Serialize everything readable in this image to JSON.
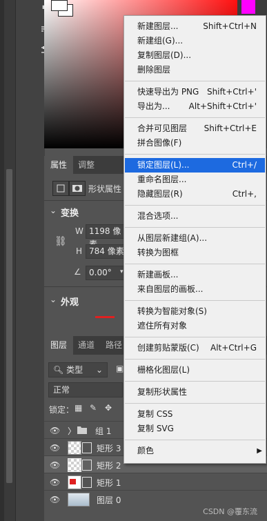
{
  "tools": {
    "icons": [
      "brush-settings-icon",
      "sliders-icon"
    ]
  },
  "properties": {
    "tabs": [
      "属性",
      "调整"
    ],
    "shape_label": "形状属性",
    "transform_header": "变换",
    "w_label": "W",
    "w_value": "1198 像素",
    "h_label": "H",
    "h_value": "784 像素",
    "angle_value": "0.00°",
    "appearance_header": "外观"
  },
  "layers": {
    "tabs": [
      "图层",
      "通道",
      "路径"
    ],
    "filter_kind": "类型",
    "blend_mode": "正常",
    "lock_label": "锁定：",
    "rows": [
      {
        "name": "组 1",
        "kind": "group",
        "selected": false
      },
      {
        "name": "矩形 3",
        "kind": "rect",
        "selected": false
      },
      {
        "name": "矩形 2",
        "kind": "rect",
        "selected": true
      },
      {
        "name": "矩形 1",
        "kind": "rect-red",
        "selected": false
      },
      {
        "name": "图层 0",
        "kind": "image",
        "selected": false
      }
    ]
  },
  "context_menu": {
    "items": [
      {
        "label": "新建图层...",
        "shortcut": "Shift+Ctrl+N"
      },
      {
        "label": "新建组(G)...",
        "shortcut": ""
      },
      {
        "label": "复制图层(D)...",
        "shortcut": ""
      },
      {
        "label": "删除图层",
        "shortcut": ""
      },
      {
        "sep": true
      },
      {
        "label": "快速导出为 PNG",
        "shortcut": "Shift+Ctrl+'"
      },
      {
        "label": "导出为...",
        "shortcut": "Alt+Shift+Ctrl+'"
      },
      {
        "sep": true
      },
      {
        "label": "合并可见图层",
        "shortcut": "Shift+Ctrl+E"
      },
      {
        "label": "拼合图像(F)",
        "shortcut": ""
      },
      {
        "sep": true
      },
      {
        "label": "锁定图层(L)...",
        "shortcut": "Ctrl+/",
        "highlight": true
      },
      {
        "label": "重命名图层...",
        "shortcut": ""
      },
      {
        "label": "隐藏图层(R)",
        "shortcut": "Ctrl+,"
      },
      {
        "sep": true
      },
      {
        "label": "混合选项...",
        "shortcut": ""
      },
      {
        "sep": true
      },
      {
        "label": "从图层新建组(A)...",
        "shortcut": ""
      },
      {
        "label": "转换为图框",
        "shortcut": ""
      },
      {
        "sep": true
      },
      {
        "label": "新建画板...",
        "shortcut": ""
      },
      {
        "label": "来自图层的画板...",
        "shortcut": ""
      },
      {
        "sep": true
      },
      {
        "label": "转换为智能对象(S)",
        "shortcut": ""
      },
      {
        "label": "遮住所有对象",
        "shortcut": ""
      },
      {
        "sep": true
      },
      {
        "label": "创建剪贴蒙版(C)",
        "shortcut": "Alt+Ctrl+G"
      },
      {
        "sep": true
      },
      {
        "label": "栅格化图层(L)",
        "shortcut": ""
      },
      {
        "sep": true
      },
      {
        "label": "复制形状属性",
        "shortcut": ""
      },
      {
        "sep": true
      },
      {
        "label": "复制 CSS",
        "shortcut": ""
      },
      {
        "label": "复制 SVG",
        "shortcut": ""
      },
      {
        "sep": true
      },
      {
        "label": "颜色",
        "shortcut": "",
        "submenu": true
      }
    ]
  },
  "watermark": "CSDN @覆东流",
  "colors": {
    "menu_highlight": "#1d6ae0",
    "hue_marker": "#ff00ff",
    "swatch_red": "#e02020"
  }
}
